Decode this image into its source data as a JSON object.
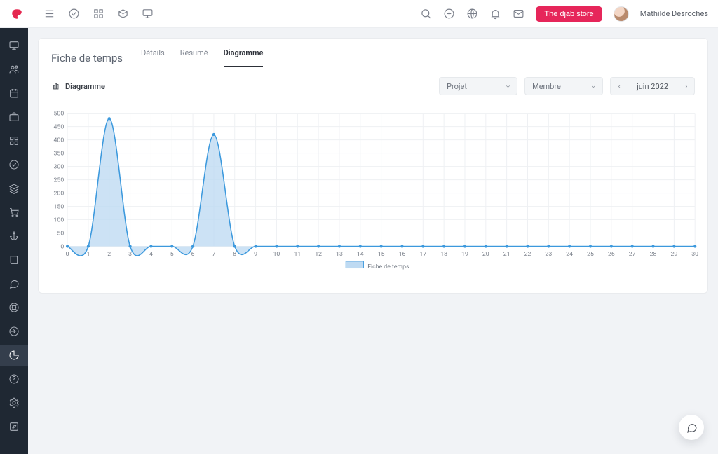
{
  "brand_color": "#e5274f",
  "topbar": {
    "store_button": "The djab store",
    "user_name": "Mathilde Desroches"
  },
  "page": {
    "title": "Fiche de temps",
    "tabs": [
      {
        "label": "Détails",
        "active": false
      },
      {
        "label": "Résumé",
        "active": false
      },
      {
        "label": "Diagramme",
        "active": true
      }
    ],
    "subtitle": "Diagramme",
    "select_project": "Projet",
    "select_member": "Membre",
    "month": "juin 2022"
  },
  "rail_icons": [
    "monitor-icon",
    "users-icon",
    "calendar-icon",
    "briefcase-icon",
    "grid-icon",
    "check-circle-icon",
    "layers-icon",
    "cart-icon",
    "anchor-icon",
    "book-icon",
    "message-icon",
    "life-ring-icon",
    "login-icon",
    "pie-chart-icon",
    "help-icon",
    "settings-icon",
    "edit-square-icon"
  ],
  "chart_data": {
    "type": "area",
    "title": "",
    "xlabel": "",
    "ylabel": "",
    "legend": [
      "Fiche de temps"
    ],
    "categories": [
      "0",
      "1",
      "2",
      "3",
      "4",
      "5",
      "6",
      "7",
      "8",
      "9",
      "10",
      "11",
      "12",
      "13",
      "14",
      "15",
      "16",
      "17",
      "18",
      "19",
      "20",
      "21",
      "22",
      "23",
      "24",
      "25",
      "26",
      "27",
      "28",
      "29",
      "30"
    ],
    "values": [
      0,
      0,
      480,
      0,
      0,
      0,
      0,
      420,
      0,
      0,
      0,
      0,
      0,
      0,
      0,
      0,
      0,
      0,
      0,
      0,
      0,
      0,
      0,
      0,
      0,
      0,
      0,
      0,
      0,
      0,
      0
    ],
    "y_ticks": [
      0,
      50,
      100,
      150,
      200,
      250,
      300,
      350,
      400,
      450,
      500
    ],
    "ylim": [
      0,
      500
    ]
  }
}
